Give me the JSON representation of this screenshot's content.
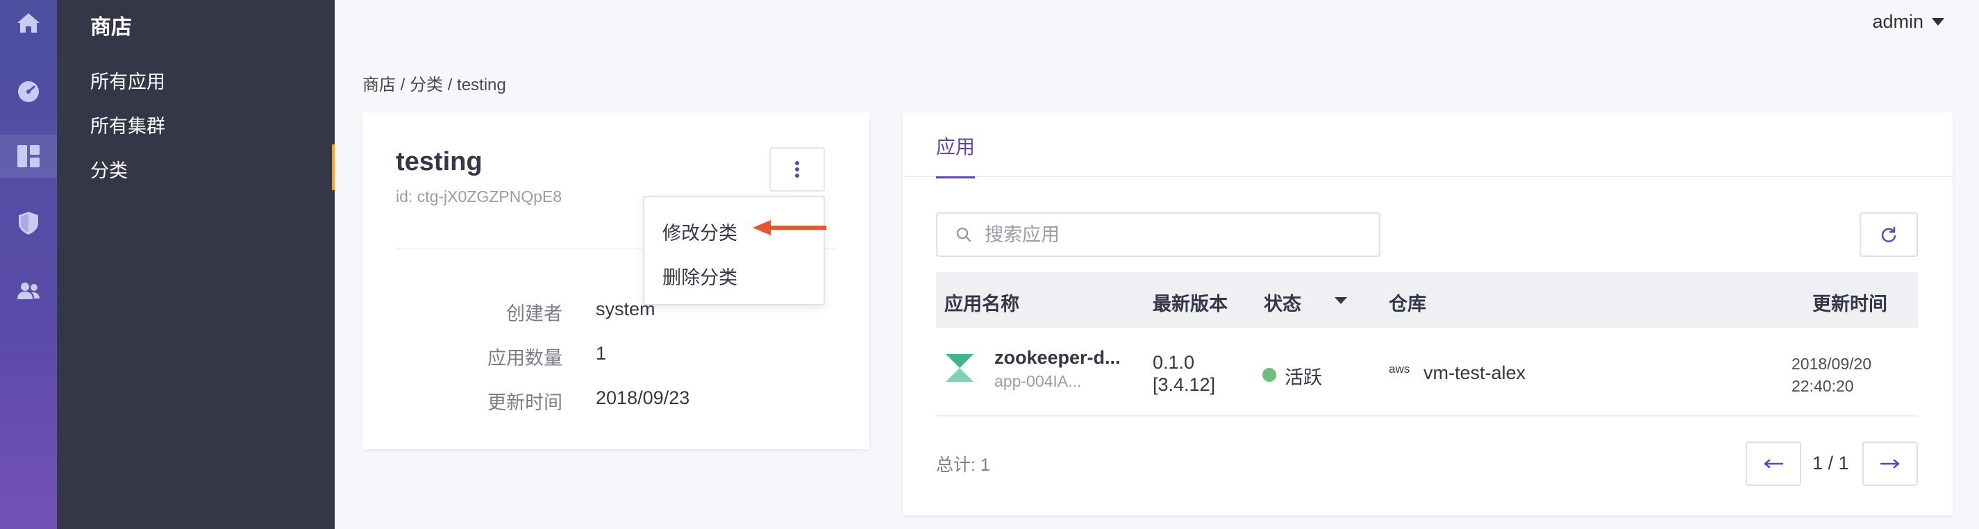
{
  "rail": {
    "items": [
      {
        "icon": "home-icon"
      },
      {
        "icon": "dashboard-gauge-icon"
      },
      {
        "icon": "store-grid-icon"
      },
      {
        "icon": "shield-icon"
      },
      {
        "icon": "users-icon"
      }
    ]
  },
  "subnav": {
    "title": "商店",
    "items": [
      {
        "label": "所有应用"
      },
      {
        "label": "所有集群"
      },
      {
        "label": "分类"
      }
    ]
  },
  "header": {
    "user": "admin"
  },
  "breadcrumb": {
    "store": "商店",
    "category": "分类",
    "current": "testing",
    "sep": " / "
  },
  "category": {
    "name": "testing",
    "id": "id: ctg-jX0ZGZPNQpE8",
    "fields": [
      {
        "label": "创建者",
        "value": "system"
      },
      {
        "label": "应用数量",
        "value": "1"
      },
      {
        "label": "更新时间",
        "value": "2018/09/23"
      }
    ]
  },
  "dropdown": {
    "items": [
      {
        "label": "修改分类"
      },
      {
        "label": "删除分类"
      }
    ]
  },
  "apps_panel": {
    "tab": "应用",
    "search_placeholder": "搜索应用",
    "columns": {
      "name": "应用名称",
      "version": "最新版本",
      "status": "状态",
      "repo": "仓库",
      "updated": "更新时间"
    },
    "rows": [
      {
        "name": "zookeeper-d...",
        "id": "app-004IA...",
        "version": "0.1.0 [3.4.12]",
        "status": "活跃",
        "repo_provider": "aws",
        "repo": "vm-test-alex",
        "updated_date": "2018/09/20",
        "updated_time": "22:40:20"
      }
    ],
    "total": "总计: 1",
    "page": "1 / 1"
  },
  "colors": {
    "accent": "#5f45b5",
    "rail_top": "#4b4fa0",
    "rail_bottom": "#7351b5",
    "subnav_bg": "#343747",
    "active_indicator": "#f5a623",
    "status_active": "#6dbf7e",
    "annotation_arrow": "#e8552f"
  }
}
